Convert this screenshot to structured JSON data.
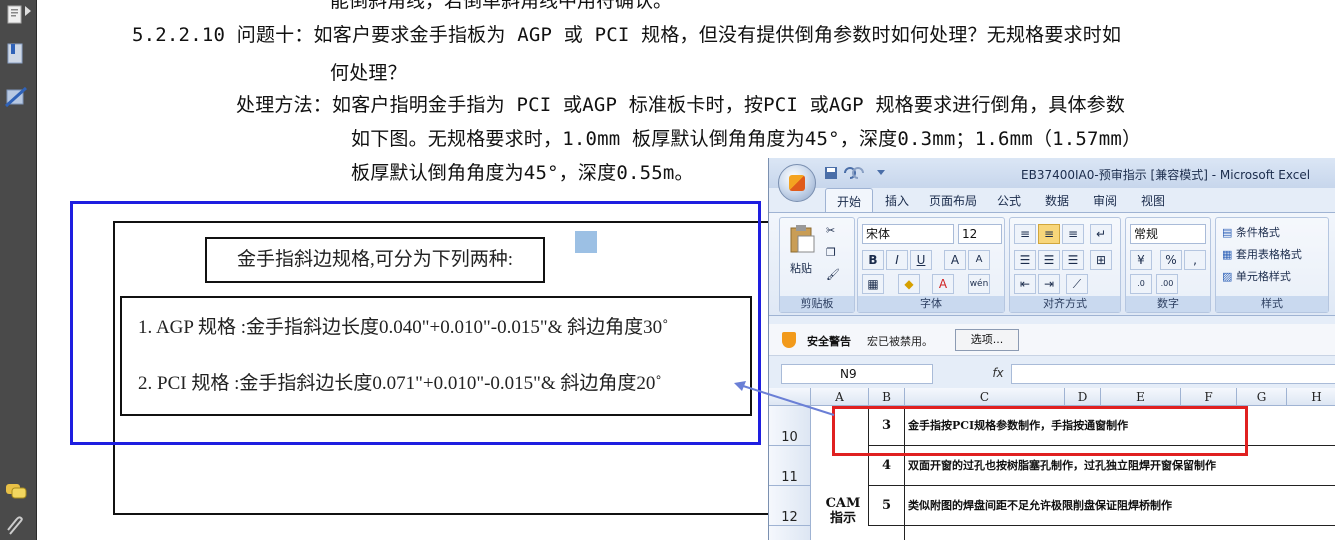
{
  "pdf_viewer": {
    "tools": [
      "pages-icon",
      "bookmark-icon",
      "signature-icon",
      "comments-icon",
      "attachment-icon"
    ]
  },
  "document": {
    "cut_line": "能倒斜角线，若倒单斜角线中用符确认。",
    "line1": "5.2.2.10 问题十：如客户要求金手指板为 AGP 或 PCI 规格，但没有提供倒角参数时如何处理？无规格要求时如",
    "line2": "何处理？",
    "line3": "处理方法：如客户指明金手指为 PCI 或AGP 标准板卡时，按PCI 或AGP 规格要求进行倒角，具体参数",
    "line4": "如下图。无规格要求时，1.0mm 板厚默认倒角角度为45°，深度0.3mm；1.6mm（1.57mm）",
    "line5": "板厚默认倒角角度为45°，深度0.55m。"
  },
  "figure": {
    "title": "金手指斜边规格,可分为下列两种:",
    "spec1": "1. AGP 规格 :金手指斜边长度0.040\"+0.010\"-0.015\"& 斜边角度30˚",
    "spec2": "2.  PCI 规格 :金手指斜边长度0.071\"+0.010\"-0.015\"& 斜边角度20˚"
  },
  "excel": {
    "title": "EB37400IA0-预审指示  [兼容模式] - Microsoft Excel",
    "tabs": [
      "开始",
      "插入",
      "页面布局",
      "公式",
      "数据",
      "审阅",
      "视图"
    ],
    "ribbon": {
      "paste_label": "粘贴",
      "clipboard_label": "剪贴板",
      "font_name": "宋体",
      "font_size": "12",
      "font_group_label": "字体",
      "align_group_label": "对齐方式",
      "number_format": "常规",
      "number_group_label": "数字",
      "style_group_label": "样式",
      "cond_format": "条件格式",
      "table_format": "套用表格格式",
      "cell_style": "单元格样式",
      "bold": "B",
      "italic": "I",
      "underline": "U",
      "percent": "%"
    },
    "security": {
      "title": "安全警告",
      "message": "宏已被禁用。",
      "options_button": "选项..."
    },
    "formula_bar": {
      "name_box": "N9",
      "fx": "fx",
      "content": ""
    },
    "columns": [
      "A",
      "B",
      "C",
      "D",
      "E",
      "F",
      "G",
      "H"
    ],
    "rows": [
      {
        "row": "10",
        "num": "3",
        "text": "金手指按PCI规格参数制作，手指按通窗制作"
      },
      {
        "row": "11",
        "num": "4",
        "text": "双面开窗的过孔也按树脂塞孔制作，过孔独立阻焊开窗保留制作"
      },
      {
        "row": "12",
        "num": "5",
        "text": "类似附图的焊盘间距不足允许极限削盘保证阻焊桥制作"
      }
    ],
    "col_a_label": "CAM 指示"
  },
  "colors": {
    "highlight_blue": "#1e1ee0",
    "highlight_red": "#e02020",
    "arrow": "#6a7fd6"
  }
}
